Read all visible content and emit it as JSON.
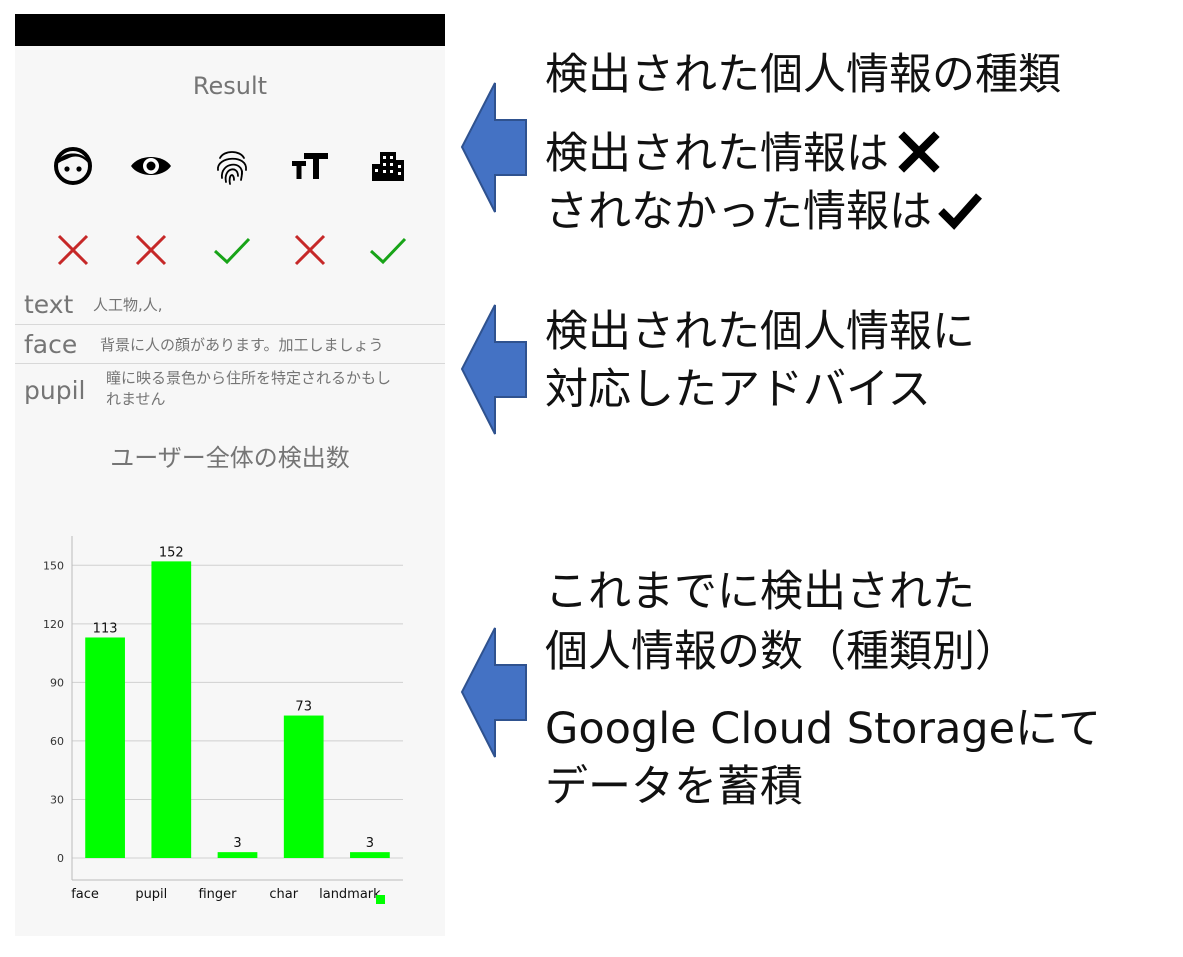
{
  "screen": {
    "title": "Result",
    "categories": [
      {
        "icon": "face-icon",
        "detected": true
      },
      {
        "icon": "eye-icon",
        "detected": true
      },
      {
        "icon": "fingerprint-icon",
        "detected": false
      },
      {
        "icon": "text-size-icon",
        "detected": true
      },
      {
        "icon": "building-icon",
        "detected": false
      }
    ],
    "advice": [
      {
        "key": "text",
        "text": "人工物,人,"
      },
      {
        "key": "face",
        "text": "背景に人の顔があります。加工しましょう"
      },
      {
        "key": "pupil",
        "text_line1": "瞳に映る景色から住所を特定されるかもし",
        "text_line2": "れません"
      }
    ],
    "stats_title": "ユーザー全体の検出数"
  },
  "chart_data": {
    "type": "bar",
    "categories": [
      "face",
      "pupil",
      "finger",
      "char",
      "landmark"
    ],
    "values": [
      113,
      152,
      3,
      73,
      3
    ],
    "yticks": [
      0,
      30,
      60,
      90,
      120,
      150
    ],
    "ylim": [
      0,
      165
    ],
    "grid": true,
    "legend": "bottom-right"
  },
  "annotations": {
    "a1_line1": "検出された個人情報の種類",
    "a1_line2": "検出された情報は",
    "a1_line3": "されなかった情報は",
    "a2_line1": "検出された個人情報に",
    "a2_line2": "対応したアドバイス",
    "a3_line1": "これまでに検出された",
    "a3_line2": "個人情報の数（種類別）",
    "a3_line3": "Google Cloud Storageにて",
    "a3_line4": "データを蓄積"
  },
  "colors": {
    "bar": "#00ff00",
    "cross": "#c62828",
    "check": "#18a418",
    "arrow_fill": "#4472c4",
    "arrow_stroke": "#2f528f"
  }
}
